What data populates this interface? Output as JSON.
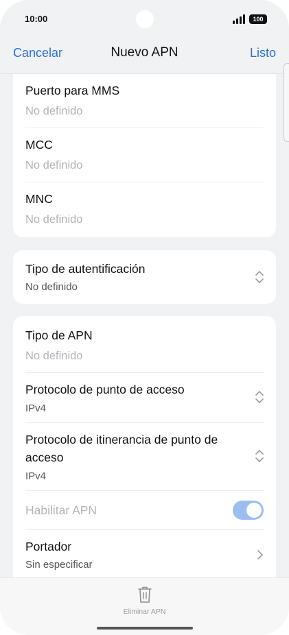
{
  "status_bar": {
    "time": "10:00",
    "battery": "100"
  },
  "nav": {
    "cancel_label": "Cancelar",
    "title": "Nuevo APN",
    "done_label": "Listo"
  },
  "section1": {
    "mms_port_label": "Puerto para MMS",
    "mms_port_value": "No definido",
    "mcc_label": "MCC",
    "mcc_value": "No definido",
    "mnc_label": "MNC",
    "mnc_value": "No definido"
  },
  "section2": {
    "auth_label": "Tipo de autentificación",
    "auth_value": "No definido"
  },
  "section3": {
    "apn_type_label": "Tipo de APN",
    "apn_type_value": "No definido",
    "protocol_label": "Protocolo de punto de acceso",
    "protocol_value": "IPv4",
    "roaming_label_line1": "Protocolo de itinerancia de punto de",
    "roaming_label_line2": "acceso",
    "roaming_value": "IPv4",
    "enable_label": "Habilitar APN",
    "enable_state": "on",
    "bearer_label": "Portador",
    "bearer_value": "Sin especificar"
  },
  "bottom_bar": {
    "delete_label": "Eliminar APN"
  },
  "colors": {
    "accent": "#2a6fd6",
    "toggle": "#9cbdf0",
    "background": "#f1f2f4"
  }
}
